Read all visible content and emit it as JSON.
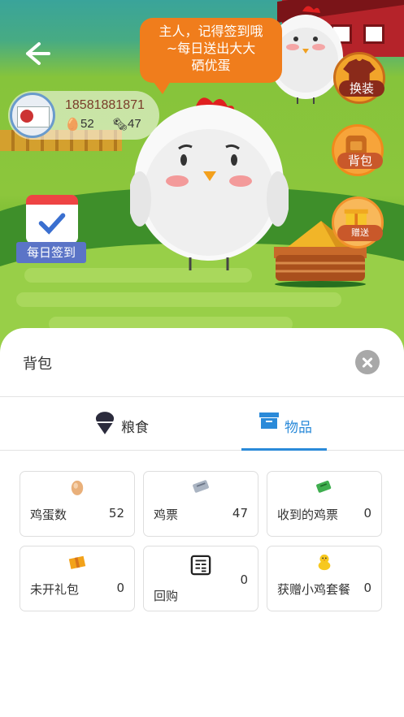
{
  "scene": {
    "bubble_line1": "主人，记得签到哦",
    "bubble_line2": "~每日送出大大",
    "bubble_line3": "硒优蛋",
    "profile": {
      "phone": "18581881871",
      "eggs": "52",
      "tickets": "47"
    },
    "buttons": {
      "outfit": "换装",
      "bag": "背包",
      "gift": "赠送",
      "checkin": "每日签到"
    }
  },
  "sheet": {
    "title": "背包",
    "tabs": [
      {
        "label": "粮食",
        "active": false
      },
      {
        "label": "物品",
        "active": true
      }
    ],
    "items": [
      {
        "icon": "egg-icon",
        "label": "鸡蛋数",
        "value": "52"
      },
      {
        "icon": "ticket-icon",
        "label": "鸡票",
        "value": "47"
      },
      {
        "icon": "received-ticket-icon",
        "label": "收到的鸡票",
        "value": "0"
      },
      {
        "icon": "gift-box-icon",
        "label": "未开礼包",
        "value": "0"
      },
      {
        "icon": "buyback-icon",
        "label": "回购",
        "value": "0"
      },
      {
        "icon": "chick-icon",
        "label": "获赠小鸡套餐",
        "value": "0"
      }
    ]
  },
  "colors": {
    "accent": "#2a8ad9",
    "bubble": "#f07d1c",
    "checkin_tag": "#5b74c7"
  }
}
